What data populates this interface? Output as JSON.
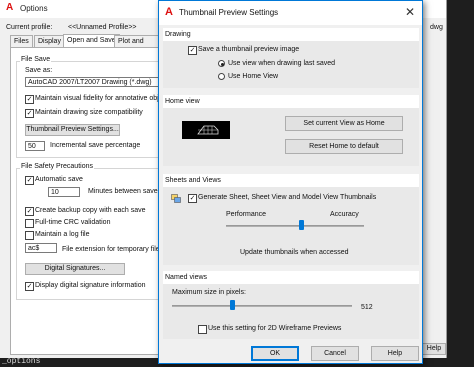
{
  "options": {
    "title": "Options",
    "current_profile_label": "Current profile:",
    "current_profile_value": "<<Unnamed Profile>>",
    "right_partial_text": "dwg",
    "tabs": [
      "Files",
      "Display",
      "Open and Save",
      "Plot and Publ"
    ],
    "file_save": {
      "header": "File Save",
      "save_as_label": "Save as:",
      "save_as_value": "AutoCAD 2007/LT2007 Drawing (*.dwg)",
      "maintain_visual": "Maintain visual fidelity for annotative objec",
      "maintain_drawing": "Maintain drawing size compatibility",
      "thumb_button": "Thumbnail Preview Settings...",
      "incremental_value": "50",
      "incremental_label": "Incremental save percentage"
    },
    "safety": {
      "header": "File Safety Precautions",
      "autosave": "Automatic save",
      "minutes_value": "10",
      "minutes_label": "Minutes between saves",
      "backup": "Create backup copy with each save",
      "crc": "Full-time CRC validation",
      "log": "Maintain a log file",
      "ext_value": "ac$",
      "ext_label": "File extension for temporary files",
      "digsig_button": "Digital Signatures...",
      "digsig_info": "Display digital signature information"
    },
    "help_button": "Help",
    "command_text": "_options"
  },
  "thumb": {
    "title": "Thumbnail Preview Settings",
    "close": "✕",
    "drawing": {
      "header": "Drawing",
      "save_thumb": "Save a thumbnail preview image",
      "use_view": "Use view when drawing last saved",
      "use_home": "Use Home View"
    },
    "home": {
      "header": "Home view",
      "set_current": "Set current View as Home",
      "reset": "Reset Home to default"
    },
    "sheets": {
      "header": "Sheets and Views",
      "generate": "Generate Sheet, Sheet View and Model View Thumbnails",
      "performance": "Performance",
      "accuracy": "Accuracy",
      "update_note": "Update thumbnails when accessed",
      "slider_level": 0.55
    },
    "named": {
      "header": "Named views",
      "max_size_label": "Maximum size in pixels:",
      "max_size_value": "512",
      "wireframe": "Use this setting for 2D Wireframe Previews",
      "slider_level": 0.33
    },
    "buttons": {
      "ok": "OK",
      "cancel": "Cancel",
      "help": "Help"
    }
  }
}
